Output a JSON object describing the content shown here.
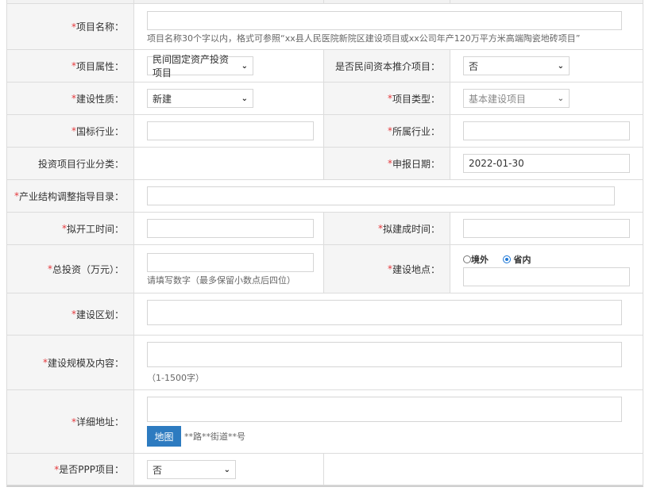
{
  "form": {
    "project_name": {
      "required": "*",
      "label": "项目名称：",
      "value": "",
      "hint": "项目名称30个字以内，格式可参照“xx县人民医院新院区建设项目或xx公司年产120万平方米高端陶瓷地砖项目”"
    },
    "project_attr": {
      "required": "*",
      "label": "项目属性：",
      "selected": "民间固定资产投资项目"
    },
    "private_promo": {
      "label": "是否民间资本推介项目：",
      "selected": "否"
    },
    "build_nature": {
      "required": "*",
      "label": "建设性质：",
      "selected": "新建"
    },
    "project_type": {
      "required": "*",
      "label": "项目类型：",
      "selected": "基本建设项目"
    },
    "national_industry": {
      "required": "*",
      "label": "国标行业：",
      "value": ""
    },
    "belong_industry": {
      "required": "*",
      "label": "所属行业：",
      "value": ""
    },
    "industry_class": {
      "label": "投资项目行业分类："
    },
    "apply_date": {
      "required": "*",
      "label": "申报日期：",
      "value": "2022-01-30"
    },
    "industry_catalog": {
      "required": "*",
      "label": "产业结构调整指导目录：",
      "value": ""
    },
    "start_time": {
      "required": "*",
      "label": "拟开工时间：",
      "value": ""
    },
    "finish_time": {
      "required": "*",
      "label": "拟建成时间：",
      "value": ""
    },
    "total_invest": {
      "required": "*",
      "label": "总投资（万元）：",
      "value": "",
      "hint": "请填写数字（最多保留小数点后四位）"
    },
    "build_location": {
      "required": "*",
      "label": "建设地点：",
      "option_abroad": "境外",
      "option_domestic": "省内",
      "value": ""
    },
    "build_zone": {
      "required": "*",
      "label": "建设区划：",
      "value": ""
    },
    "build_scale": {
      "required": "*",
      "label": "建设规模及内容：",
      "value": "",
      "hint": "（1-1500字）"
    },
    "detail_address": {
      "required": "*",
      "label": "详细地址：",
      "value": "",
      "map_button": "地图",
      "hint": "**路**街道**号"
    },
    "ppp": {
      "required": "*",
      "label": "是否PPP项目：",
      "selected": "否"
    }
  }
}
